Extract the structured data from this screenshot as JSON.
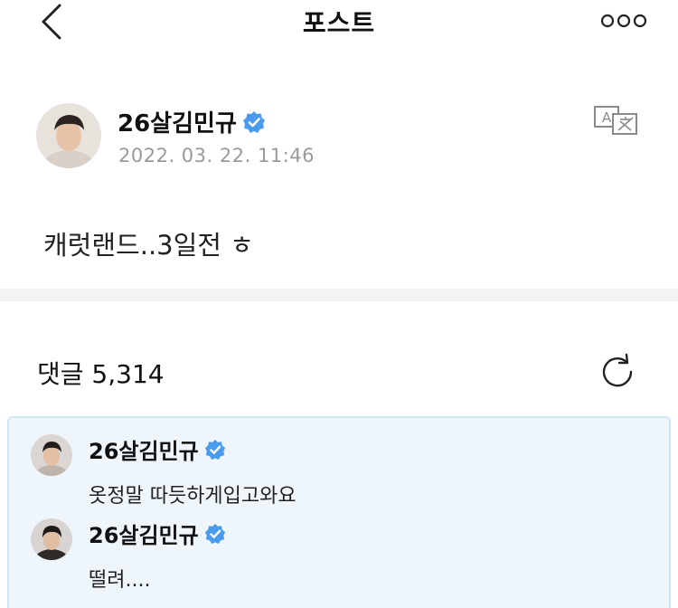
{
  "header": {
    "title": "포스트",
    "back_icon": "chevron-left-icon",
    "more_icon": "more-dots-icon"
  },
  "post": {
    "author": "26살김민규",
    "timestamp": "2022. 03. 22. 11:46",
    "text": "캐럿랜드..3일전 ㅎ",
    "translate_icon": "translate-icon"
  },
  "comments": {
    "label": "댓글 5,314",
    "refresh_icon": "refresh-icon",
    "items": [
      {
        "author": "26살김민규",
        "text": "옷정말 따듯하게입고와요"
      },
      {
        "author": "26살김민규",
        "text": "떨려...."
      }
    ]
  },
  "colors": {
    "verified": "#4a9bee",
    "highlight_bg": "#eef6fb",
    "highlight_border": "#cfe5f3",
    "timestamp": "#9a9a9a",
    "divider": "#f3f3f4"
  }
}
